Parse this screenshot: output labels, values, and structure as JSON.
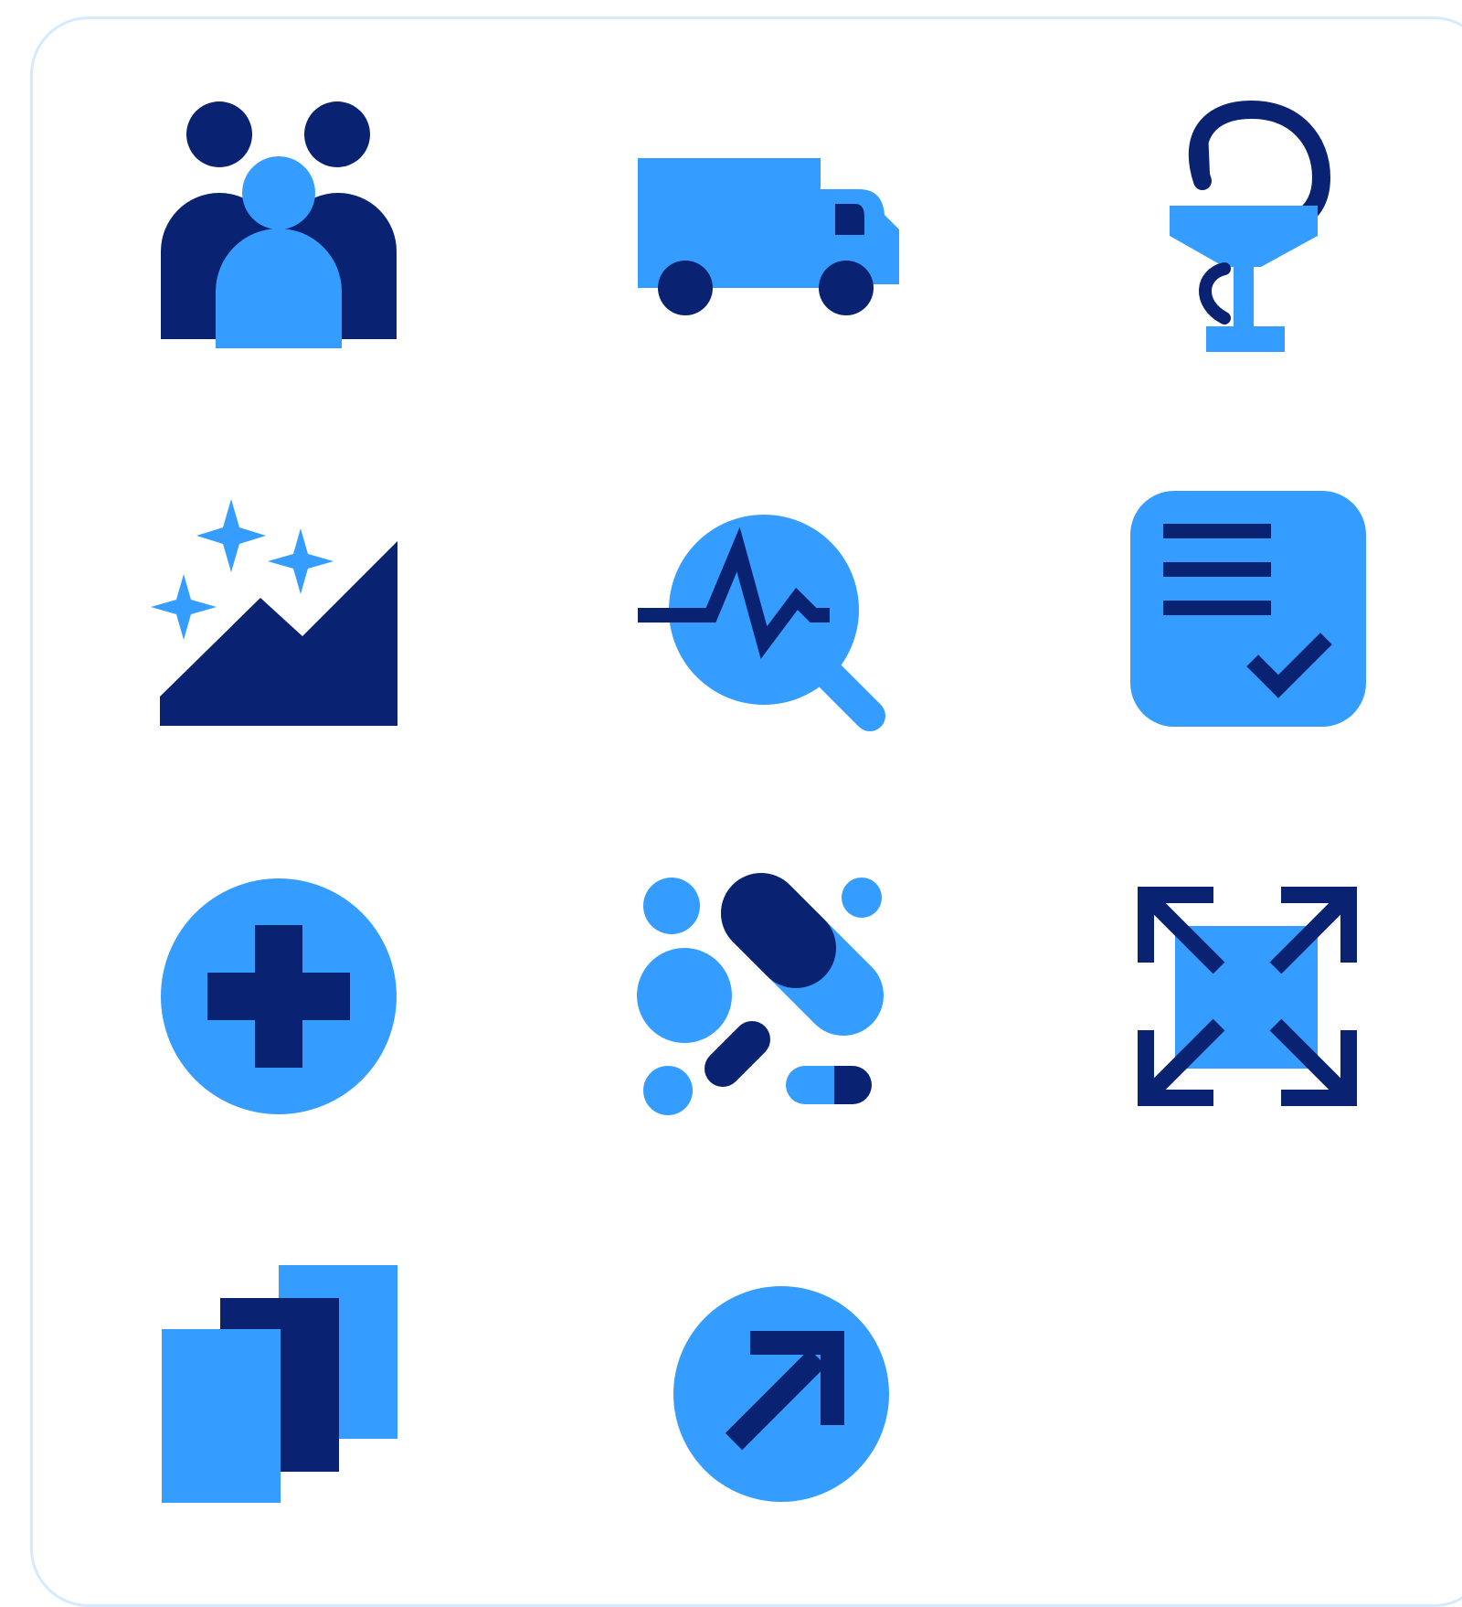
{
  "colors": {
    "light": "#359dff",
    "dark": "#0a2272",
    "card_border": "#d6eaff",
    "background": "#ffffff"
  },
  "icons": [
    {
      "name": "people-group-icon"
    },
    {
      "name": "delivery-truck-icon"
    },
    {
      "name": "pharmacy-snake-cup-icon"
    },
    {
      "name": "sparkle-mountain-icon"
    },
    {
      "name": "search-pulse-icon"
    },
    {
      "name": "checklist-document-icon"
    },
    {
      "name": "medical-plus-icon"
    },
    {
      "name": "pills-capsules-icon"
    },
    {
      "name": "expand-arrows-icon"
    },
    {
      "name": "stacked-pages-icon"
    },
    {
      "name": "arrow-up-right-icon"
    }
  ]
}
